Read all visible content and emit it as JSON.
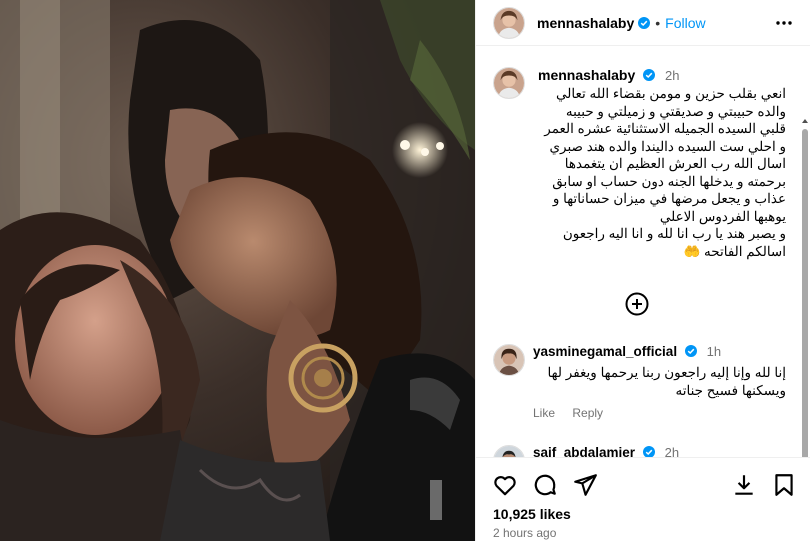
{
  "post": {
    "username": "mennashalaby",
    "follow_label": "Follow",
    "separator": "•"
  },
  "caption": {
    "username": "mennashalaby",
    "time": "2h",
    "lines": [
      "انعي بقلب حزين و مومن بقضاء الله تعالي",
      "والده حبيبتي و صديقتي و زميلتي و حبيبه",
      "قلبي السيده الجميله الاستثنائية عشره العمر",
      "و احلي ست السيده داليندا والده هند صبري",
      "اسال الله رب العرش العظيم ان يتغمدها",
      "برحمته و يدخلها الجنه دون حساب او سابق",
      "عذاب و يجعل مرضها في ميزان حساناتها و",
      "يوهبها الفردوس الاعلي",
      "و يصبر هند يا رب انا لله و انا اليه راجعون",
      "اسالكم الفاتحه 🤲"
    ]
  },
  "comments": [
    {
      "username": "yasminegamal_official",
      "time": "1h",
      "lines": [
        "إنا لله وإنا إليه راجعون ربنا يرحمها ويغفر لها",
        "ويسكنها فسيح جناته"
      ],
      "like_label": "Like",
      "reply_label": "Reply"
    },
    {
      "username": "saif_abdalamier",
      "time": "2h"
    }
  ],
  "footer": {
    "likes": "10,925 likes",
    "posted": "2 hours ago"
  },
  "icons": {
    "more": "more-horizontal-icon",
    "add_comment": "plus-circle-icon",
    "like": "heart-icon",
    "comment": "comment-icon",
    "share": "send-icon",
    "download": "download-icon",
    "save": "bookmark-icon",
    "verified": "verified-badge-icon"
  },
  "colors": {
    "accent": "#0095f6",
    "muted": "#737373",
    "border": "#efefef"
  }
}
